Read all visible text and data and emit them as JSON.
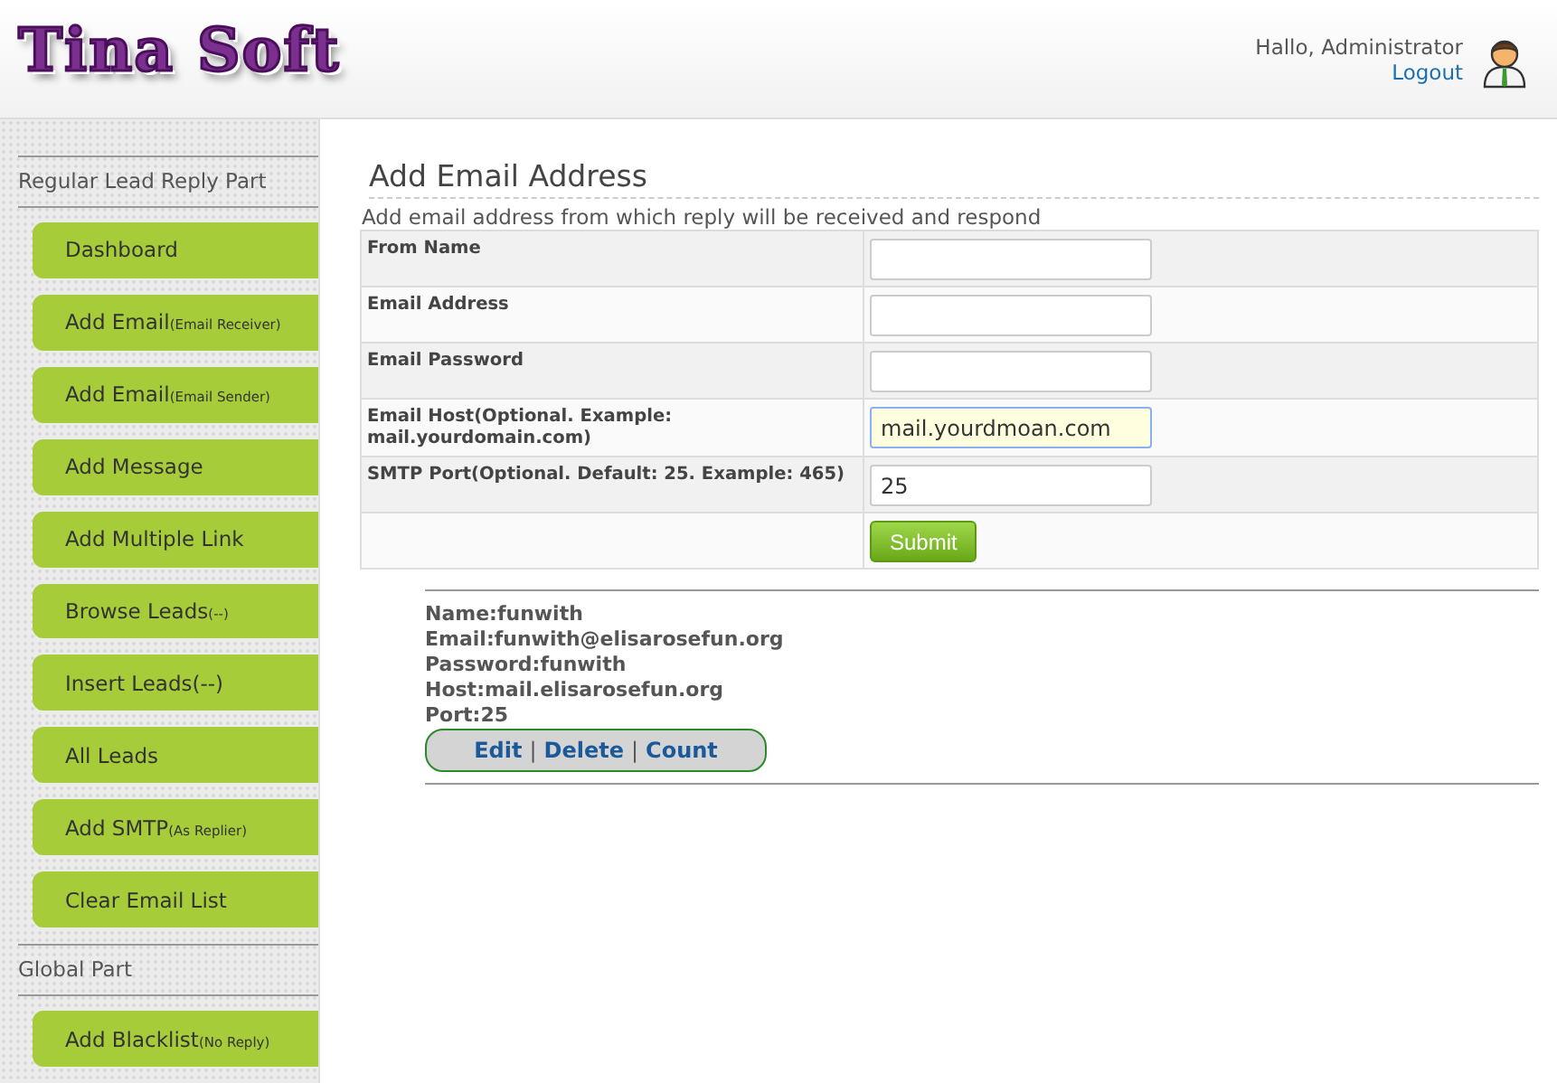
{
  "header": {
    "logo": "Tina Soft",
    "greeting": "Hallo, Administrator",
    "logout": "Logout"
  },
  "sidebar": [
    {
      "kind": "section",
      "label": "Regular Lead Reply Part"
    },
    {
      "kind": "item",
      "label": "Dashboard"
    },
    {
      "kind": "item",
      "label": "Add Email",
      "note": "(Email Receiver)"
    },
    {
      "kind": "item",
      "label": "Add Email",
      "note": "(Email Sender)"
    },
    {
      "kind": "item",
      "label": "Add Message"
    },
    {
      "kind": "item",
      "label": "Add Multiple Link"
    },
    {
      "kind": "item",
      "label": "Browse Leads",
      "note": "(--)"
    },
    {
      "kind": "item",
      "label": "Insert Leads(--)"
    },
    {
      "kind": "item",
      "label": "All Leads"
    },
    {
      "kind": "item",
      "label": "Add SMTP",
      "note": "(As Replier)"
    },
    {
      "kind": "item",
      "label": "Clear Email List"
    },
    {
      "kind": "section",
      "label": "Global Part"
    },
    {
      "kind": "item",
      "label": "Add Blacklist",
      "note": "(No Reply)"
    }
  ],
  "form": {
    "title": "Add Email Address",
    "description": "Add email address from which reply will be received and respond",
    "fields": [
      {
        "label": "From Name",
        "focused": false
      },
      {
        "label": "Email Address",
        "focused": false
      },
      {
        "label": "Email Password",
        "focused": false
      },
      {
        "label": "Email Host(Optional. Example: mail.yourdomain.com)",
        "value": "mail.yourdmoan.com",
        "focused": true
      },
      {
        "label": "SMTP Port(Optional. Default: 25. Example: 465)",
        "value": "25",
        "focused": false
      }
    ],
    "submit": "Submit"
  },
  "record": {
    "lines": [
      "Name:funwith",
      "Email:funwith@elisarosefun.org",
      "Password:funwith",
      "Host:mail.elisarosefun.org",
      "Port:25"
    ],
    "actions": [
      "Edit",
      "Delete",
      "Count"
    ],
    "separator": "|"
  }
}
